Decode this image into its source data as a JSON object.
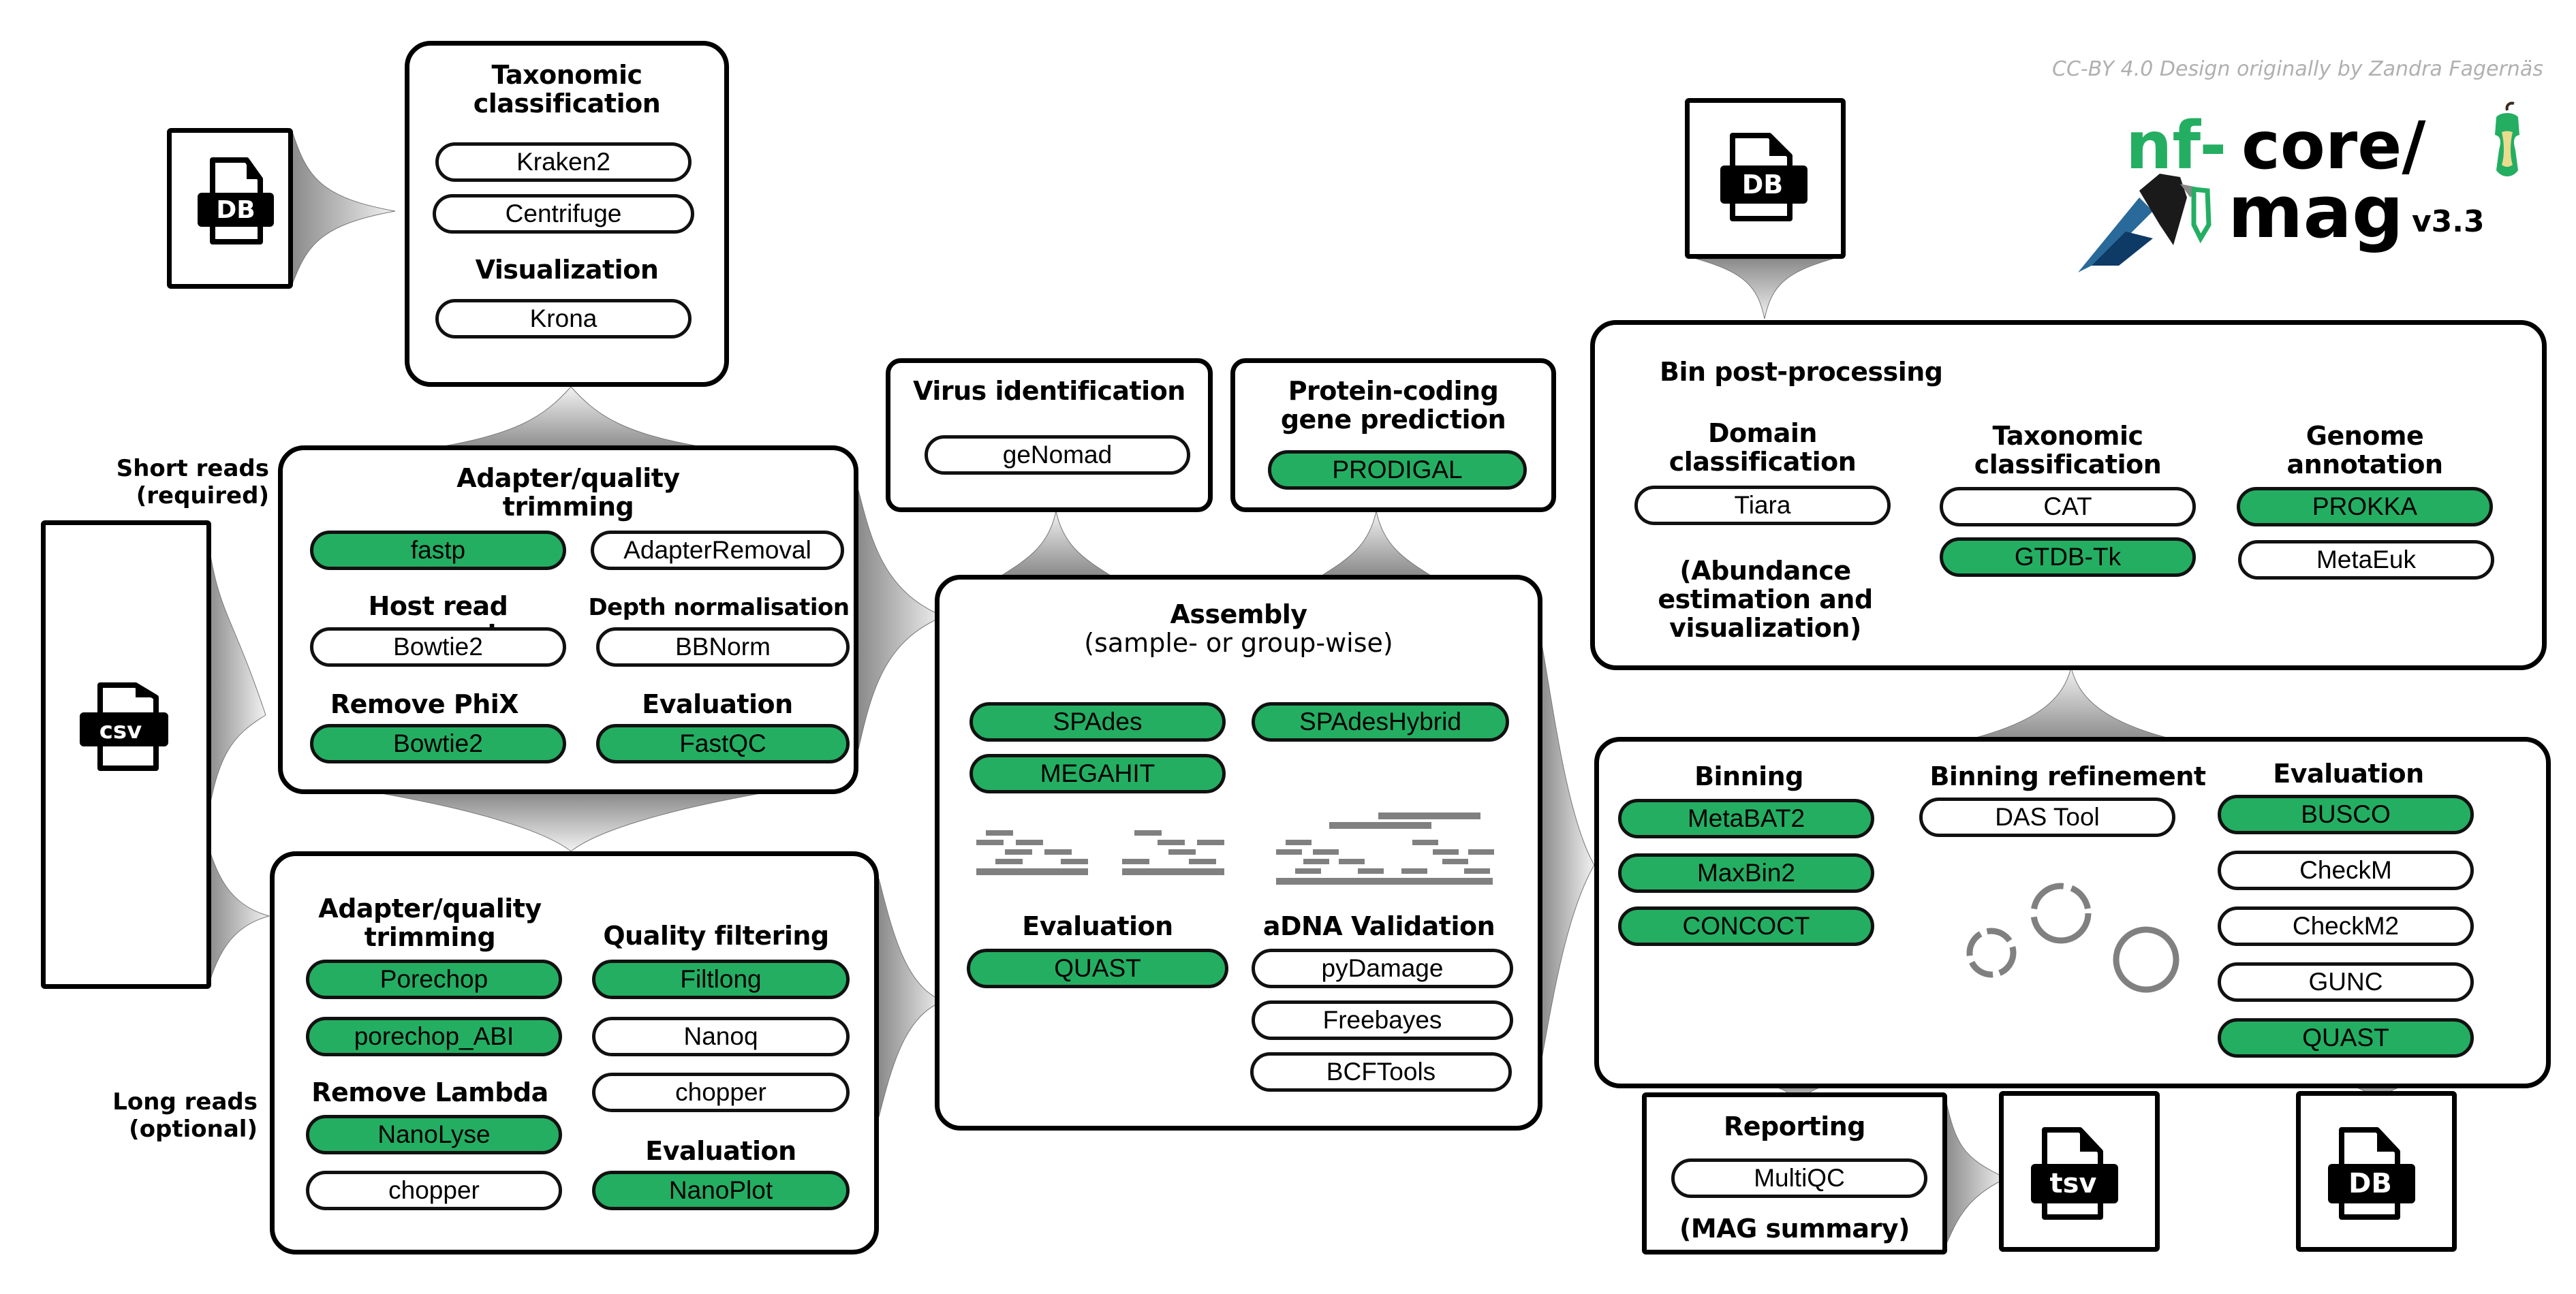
{
  "credit": "CC-BY 4.0 Design originally by Zandra Fagernäs",
  "logo": {
    "prefix": "nf-",
    "core": "core/",
    "name": "mag",
    "version": "v3.3"
  },
  "colors": {
    "selected_tool": "#24ae62",
    "unselected_tool": "#ffffff",
    "connector": "#9a9a9a",
    "credit_text": "#b0b0b0"
  },
  "inputs": {
    "db_top_left": {
      "label": "DB",
      "icon": "database-file-icon"
    },
    "csv": {
      "label": "csv",
      "icon": "csv-file-icon"
    },
    "short_reads": "Short reads\n(required)",
    "long_reads": "Long reads\n(optional)",
    "db_top_right": {
      "label": "DB",
      "icon": "database-file-icon"
    }
  },
  "taxonomic_box": {
    "title": "Taxonomic\nclassification",
    "tools": [
      {
        "label": "Kraken2",
        "selected": false
      },
      {
        "label": "Centrifuge",
        "selected": false
      }
    ],
    "viz_title": "Visualization",
    "viz_tools": [
      {
        "label": "Krona",
        "selected": false
      }
    ]
  },
  "short_reads_box": {
    "trim_title": "Adapter/quality\ntrimming",
    "trim_tools": [
      {
        "label": "fastp",
        "selected": true
      },
      {
        "label": "AdapterRemoval",
        "selected": false
      }
    ],
    "host_title": "Host read removal",
    "host_tools": [
      {
        "label": "Bowtie2",
        "selected": false
      }
    ],
    "depth_title": "Depth normalisation",
    "depth_tools": [
      {
        "label": "BBNorm",
        "selected": false
      }
    ],
    "phix_title": "Remove PhiX",
    "phix_tools": [
      {
        "label": "Bowtie2",
        "selected": true
      }
    ],
    "eval_title": "Evaluation",
    "eval_tools": [
      {
        "label": "FastQC",
        "selected": true
      }
    ]
  },
  "long_reads_box": {
    "trim_title": "Adapter/quality\ntrimming",
    "trim_tools": [
      {
        "label": "Porechop",
        "selected": true
      },
      {
        "label": "porechop_ABI",
        "selected": true
      }
    ],
    "filter_title": "Quality filtering",
    "filter_tools": [
      {
        "label": "Filtlong",
        "selected": true
      },
      {
        "label": "Nanoq",
        "selected": false
      },
      {
        "label": "chopper",
        "selected": false
      }
    ],
    "lambda_title": "Remove Lambda",
    "lambda_tools": [
      {
        "label": "NanoLyse",
        "selected": true
      },
      {
        "label": "chopper",
        "selected": false
      }
    ],
    "eval_title": "Evaluation",
    "eval_tools": [
      {
        "label": "NanoPlot",
        "selected": true
      }
    ]
  },
  "virus_box": {
    "title": "Virus identification",
    "tools": [
      {
        "label": "geNomad",
        "selected": false
      }
    ]
  },
  "protein_box": {
    "title": "Protein-coding\ngene prediction",
    "tools": [
      {
        "label": "PRODIGAL",
        "selected": true
      }
    ]
  },
  "assembly_box": {
    "title": "Assembly",
    "subtitle": "(sample- or group-wise)",
    "tools_left": [
      {
        "label": "SPAdes",
        "selected": true
      },
      {
        "label": "MEGAHIT",
        "selected": true
      }
    ],
    "tools_right": [
      {
        "label": "SPAdesHybrid",
        "selected": true
      }
    ],
    "eval_title": "Evaluation",
    "eval_tools": [
      {
        "label": "QUAST",
        "selected": true
      }
    ],
    "adna_title": "aDNA Validation",
    "adna_tools": [
      {
        "label": "pyDamage",
        "selected": false
      },
      {
        "label": "Freebayes",
        "selected": false
      },
      {
        "label": "BCFTools",
        "selected": false
      }
    ]
  },
  "bin_post_box": {
    "title": "Bin post-processing",
    "domain_title": "Domain\nclassification",
    "domain_tools": [
      {
        "label": "Tiara",
        "selected": false
      }
    ],
    "abundance_note": "(Abundance\nestimation and\nvisualization)",
    "tax_title": "Taxonomic\nclassification",
    "tax_tools": [
      {
        "label": "CAT",
        "selected": false
      },
      {
        "label": "GTDB-Tk",
        "selected": true
      }
    ],
    "genome_title": "Genome\nannotation",
    "genome_tools": [
      {
        "label": "PROKKA",
        "selected": true
      },
      {
        "label": "MetaEuk",
        "selected": false
      }
    ]
  },
  "binning_box": {
    "binning_title": "Binning",
    "binning_tools": [
      {
        "label": "MetaBAT2",
        "selected": true
      },
      {
        "label": "MaxBin2",
        "selected": true
      },
      {
        "label": "CONCOCT",
        "selected": true
      }
    ],
    "refine_title": "Binning refinement",
    "refine_tools": [
      {
        "label": "DAS Tool",
        "selected": false
      }
    ],
    "eval_title": "Evaluation",
    "eval_tools": [
      {
        "label": "BUSCO",
        "selected": true
      },
      {
        "label": "CheckM",
        "selected": false
      },
      {
        "label": "CheckM2",
        "selected": false
      },
      {
        "label": "GUNC",
        "selected": false
      },
      {
        "label": "QUAST",
        "selected": true
      }
    ]
  },
  "reporting_box": {
    "title": "Reporting",
    "tools": [
      {
        "label": "MultiQC",
        "selected": false
      }
    ],
    "note": "(MAG summary)"
  },
  "outputs": {
    "tsv": {
      "label": "tsv",
      "icon": "tsv-file-icon"
    },
    "db": {
      "label": "DB",
      "icon": "database-file-icon"
    }
  }
}
